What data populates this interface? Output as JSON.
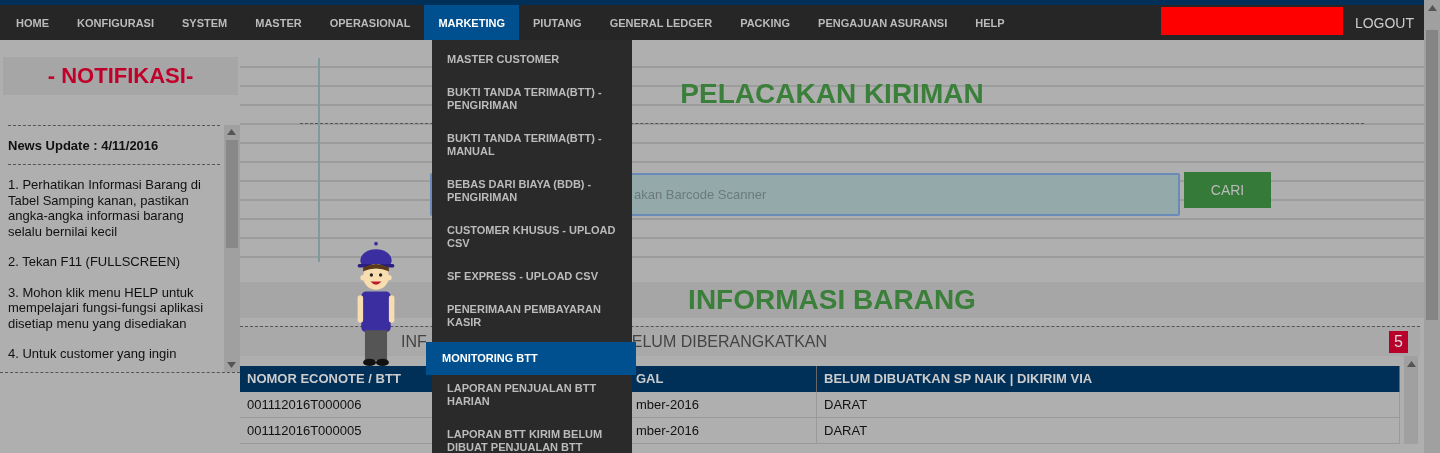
{
  "nav": {
    "items": [
      {
        "label": "HOME",
        "selected": false
      },
      {
        "label": "KONFIGURASI",
        "selected": false
      },
      {
        "label": "SYSTEM",
        "selected": false
      },
      {
        "label": "MASTER",
        "selected": false
      },
      {
        "label": "OPERASIONAL",
        "selected": false
      },
      {
        "label": "MARKETING",
        "selected": true
      },
      {
        "label": "PIUTANG",
        "selected": false
      },
      {
        "label": "GENERAL LEDGER",
        "selected": false
      },
      {
        "label": "PACKING",
        "selected": false
      },
      {
        "label": "PENGAJUAN ASURANSI",
        "selected": false
      },
      {
        "label": "HELP",
        "selected": false
      }
    ],
    "logout": "LOGOUT"
  },
  "marketing_menu": {
    "items": [
      {
        "label": "MASTER CUSTOMER",
        "selected": false
      },
      {
        "label": "BUKTI TANDA TERIMA(BTT) - PENGIRIMAN",
        "selected": false
      },
      {
        "label": "BUKTI TANDA TERIMA(BTT) - MANUAL",
        "selected": false
      },
      {
        "label": "BEBAS DARI BIAYA (BDB) - PENGIRIMAN",
        "selected": false
      },
      {
        "label": "CUSTOMER KHUSUS - UPLOAD CSV",
        "selected": false
      },
      {
        "label": "SF EXPRESS - UPLOAD CSV",
        "selected": false
      },
      {
        "label": "PENERIMAAN PEMBAYARAN KASIR",
        "selected": false
      },
      {
        "label": "MONITORING BTT",
        "selected": true
      },
      {
        "label": "LAPORAN PENJUALAN BTT HARIAN",
        "selected": false
      },
      {
        "label": "LAPORAN BTT KIRIM BELUM DIBUAT PENJUALAN BTT",
        "selected": false
      }
    ]
  },
  "notification": {
    "title": "- NOTIFIKASI-",
    "news_title": "News Update : 4/11/2016",
    "paragraphs": [
      "1. Perhatikan Informasi Barang di Tabel Samping kanan, pastikan angka-angka informasi barang selalu bernilai kecil",
      "2. Tekan F11 (FULLSCREEN)",
      "3. Mohon klik menu HELP untuk mempelajari fungsi-fungsi aplikasi disetiap menu yang disediakan",
      "4. Untuk customer yang ingin"
    ]
  },
  "tracking": {
    "title": "PELACAKAN KIRIMAN",
    "search": {
      "placeholder": "akan Barcode Scanner"
    },
    "button": "CARI"
  },
  "info": {
    "title": "INFORMASI BARANG",
    "subheading_parts": [
      "INF",
      "ELUM DIBERANGKATKAN"
    ],
    "badge": "5",
    "table": {
      "columns": [
        "NOMOR ECONOTE / BTT",
        "GAL",
        "BELUM DIBUATKAN SP NAIK | DIKIRIM VIA"
      ],
      "rows": [
        [
          "001112016T000006",
          "mber-2016",
          "DARAT"
        ],
        [
          "001112016T000005",
          "mber-2016",
          "DARAT"
        ]
      ]
    }
  }
}
